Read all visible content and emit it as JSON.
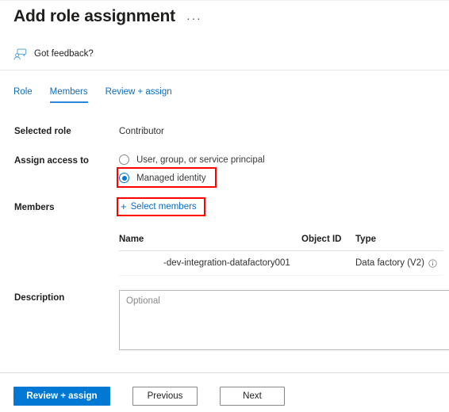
{
  "header": {
    "title": "Add role assignment",
    "overflow_menu": "···",
    "overflow_icon_name": "ellipsis-icon"
  },
  "feedback": {
    "label": "Got feedback?",
    "icon": "feedback-person-icon"
  },
  "tabs": [
    {
      "label": "Role",
      "active": false
    },
    {
      "label": "Members",
      "active": true
    },
    {
      "label": "Review + assign",
      "active": false
    }
  ],
  "fields": {
    "selected_role": {
      "label": "Selected role",
      "value": "Contributor"
    },
    "assign_access_to": {
      "label": "Assign access to",
      "options": [
        {
          "label": "User, group, or service principal",
          "selected": false
        },
        {
          "label": "Managed identity",
          "selected": true
        }
      ]
    },
    "members": {
      "label": "Members",
      "select_members_label": "Select members",
      "plus_icon": "plus-icon"
    },
    "description": {
      "label": "Description",
      "value": "",
      "placeholder": "Optional"
    }
  },
  "members_table": {
    "columns": [
      "Name",
      "Object ID",
      "Type"
    ],
    "rows": [
      {
        "name": "-dev-integration-datafactory001",
        "object_id": "",
        "type": "Data factory (V2)",
        "type_info_icon": "info-icon"
      }
    ]
  },
  "footer": {
    "primary": "Review + assign",
    "previous": "Previous",
    "next": "Next"
  },
  "annotations": [
    {
      "target": "managed-identity-radio",
      "color": "#ff0000"
    },
    {
      "target": "select-members-link",
      "color": "#ff0000"
    }
  ],
  "colors": {
    "accent_blue": "#0078d4",
    "link_blue": "#0f6cbd",
    "tab_underline": "#2b88d8",
    "annotation_red": "#ff0000",
    "text_primary": "#201f1e",
    "border_grey": "#8a8886"
  }
}
